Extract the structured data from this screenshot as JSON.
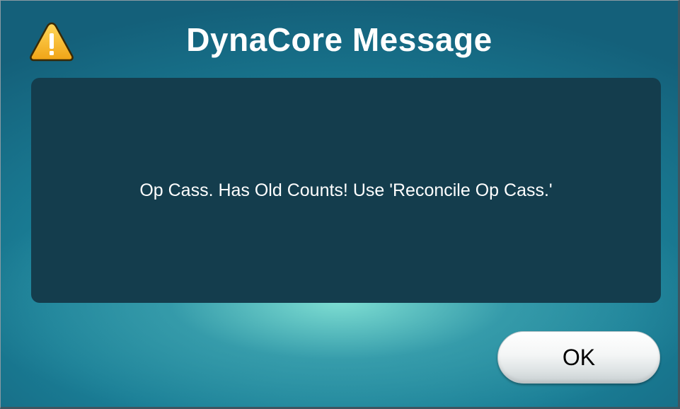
{
  "dialog": {
    "title": "DynaCore Message",
    "title_icon": "warning-icon",
    "message": "Op Cass. Has Old Counts! Use 'Reconcile Op Cass.'",
    "ok_label": "OK"
  },
  "colors": {
    "background_teal": "#1a7e96",
    "panel": "#143d4d",
    "warning_yellow": "#f5b51a",
    "text": "#ffffff"
  }
}
